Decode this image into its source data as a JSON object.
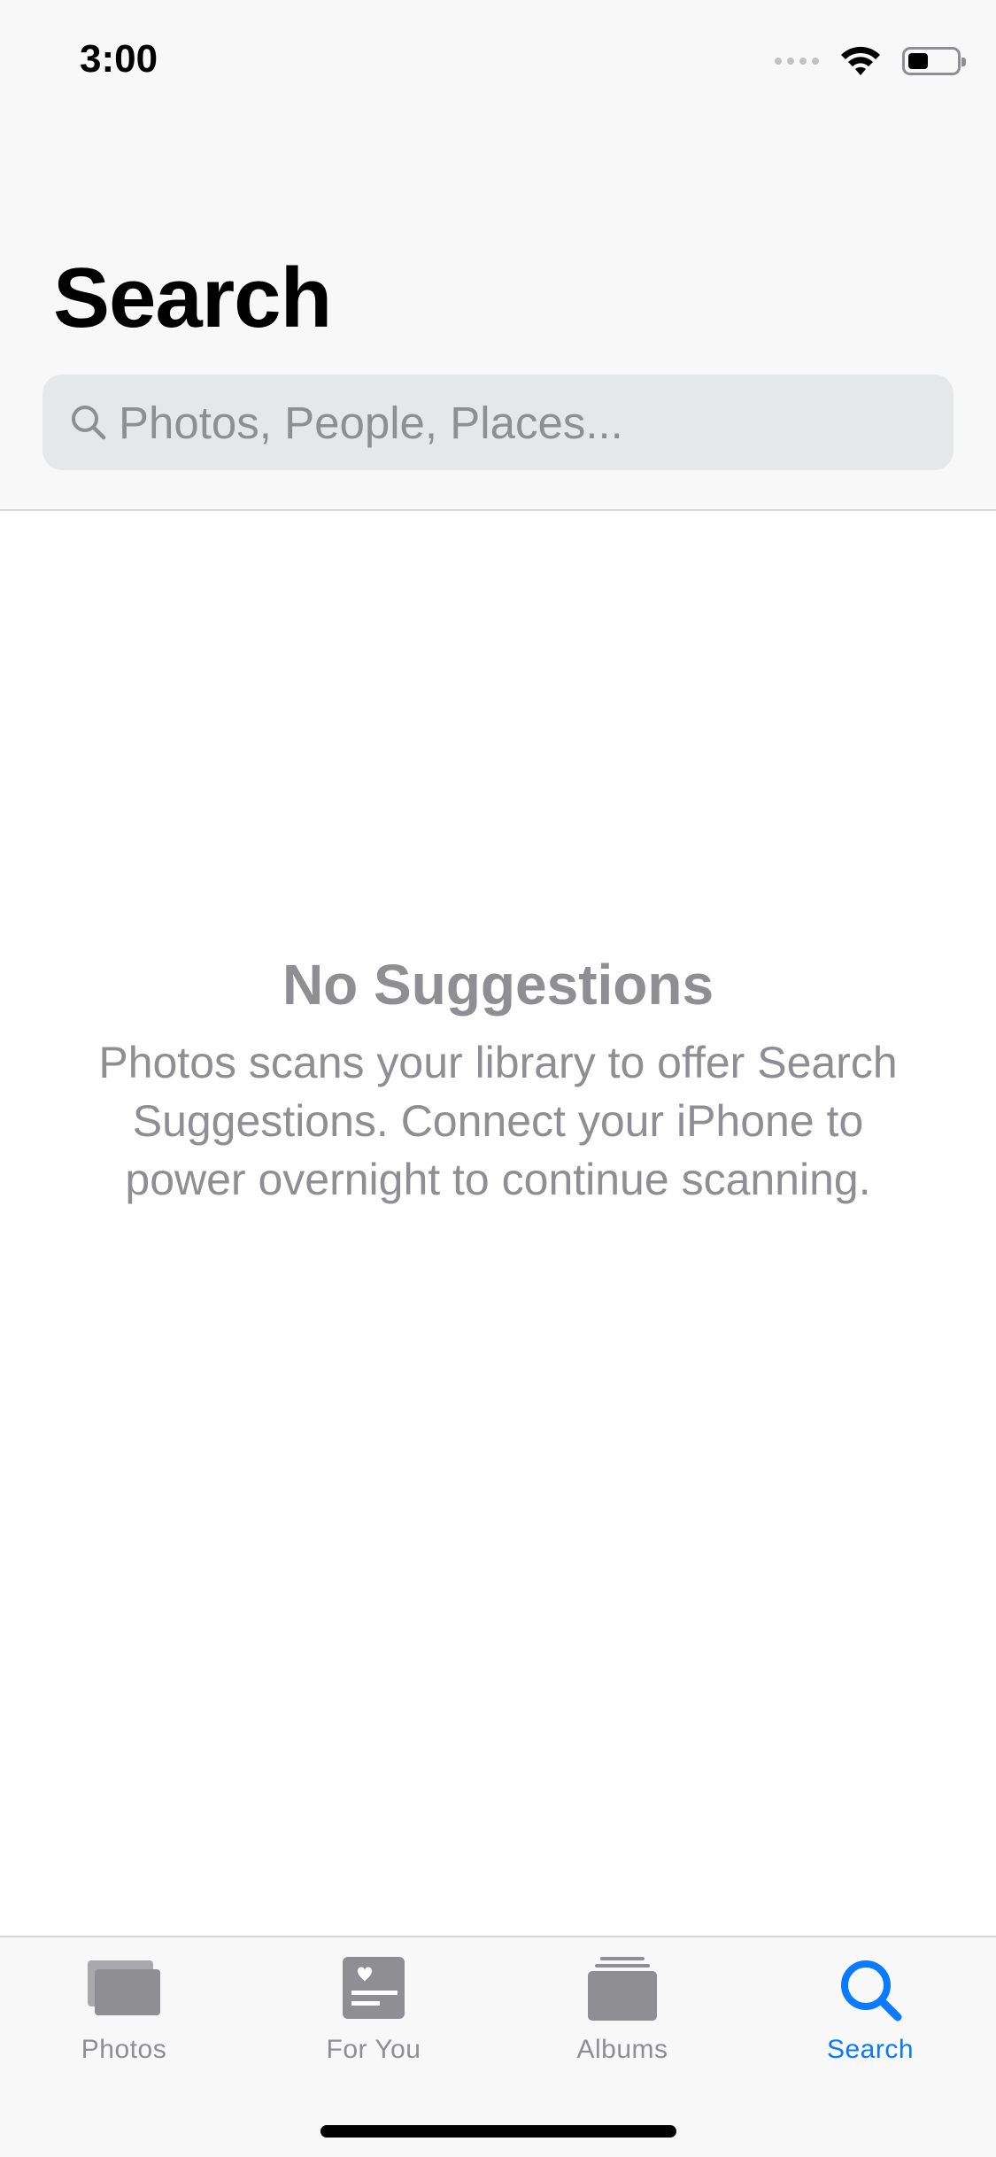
{
  "status_bar": {
    "time": "3:00"
  },
  "header": {
    "title": "Search"
  },
  "search": {
    "placeholder": "Photos, People, Places...",
    "value": ""
  },
  "empty_state": {
    "title": "No Suggestions",
    "body": "Photos scans your library to offer Search Suggestions. Connect your iPhone to power overnight to continue scanning."
  },
  "tabbar": {
    "tabs": [
      {
        "label": "Photos",
        "icon": "photos-icon",
        "active": false
      },
      {
        "label": "For You",
        "icon": "for-you-icon",
        "active": false
      },
      {
        "label": "Albums",
        "icon": "albums-icon",
        "active": false
      },
      {
        "label": "Search",
        "icon": "search-icon",
        "active": true
      }
    ]
  },
  "colors": {
    "accent": "#0a7aff",
    "inactive": "#8e8e93",
    "bar_background": "#f8f8f8",
    "search_field": "#e6e7e9"
  }
}
